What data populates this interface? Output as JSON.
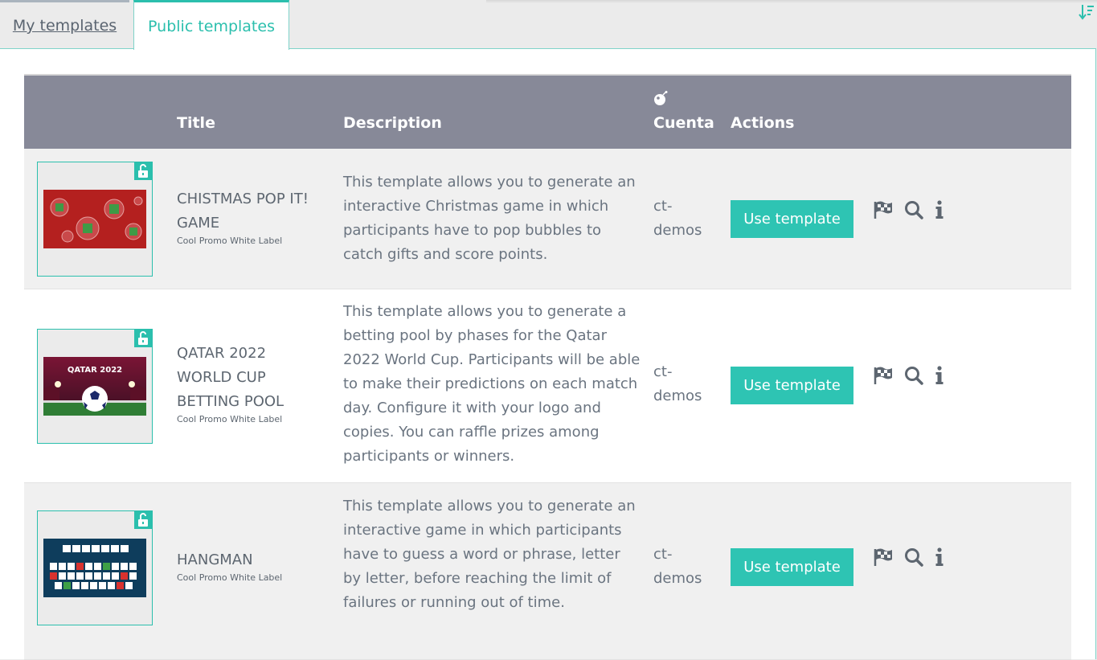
{
  "tabs": {
    "my_templates": "My templates",
    "public_templates": "Public templates"
  },
  "table": {
    "headers": {
      "title": "Title",
      "description": "Description",
      "cuenta": "Cuenta",
      "actions": "Actions"
    },
    "rows": [
      {
        "title_line1": "CHISTMAS POP IT!",
        "title_line2": "GAME",
        "subtitle": "Cool Promo White Label",
        "description": "This template allows you to generate an interactive Christmas game in which participants have to pop bubbles to catch gifts and score points.",
        "cuenta_line1": "ct-",
        "cuenta_line2": "demos",
        "button": "Use template"
      },
      {
        "title_line1": "QATAR 2022",
        "title_line2": "WORLD CUP",
        "title_line3": "BETTING POOL",
        "subtitle": "Cool Promo White Label",
        "thumb_text": "QATAR 2022",
        "description": "This template allows you to generate a betting pool by phases for the Qatar 2022 World Cup. Participants will be able to make their predictions on each match day. Configure it with your logo and copies. You can raffle prizes among participants or winners.",
        "cuenta_line1": "ct-",
        "cuenta_line2": "demos",
        "button": "Use template"
      },
      {
        "title_line1": "HANGMAN",
        "subtitle": "Cool Promo White Label",
        "description": "This template allows you to generate an interactive game in which participants have to guess a word or phrase, letter by letter, before reaching the limit of failures or running out of time.",
        "cuenta_line1": "ct-",
        "cuenta_line2": "demos",
        "button": "Use template"
      }
    ]
  },
  "colors": {
    "accent": "#2ec4b3",
    "header_bg": "#878998",
    "text": "#6a7480"
  },
  "icons": [
    "sort-icon",
    "bomb-icon",
    "unlock-icon",
    "checkered-flag-icon",
    "search-icon",
    "info-icon"
  ]
}
